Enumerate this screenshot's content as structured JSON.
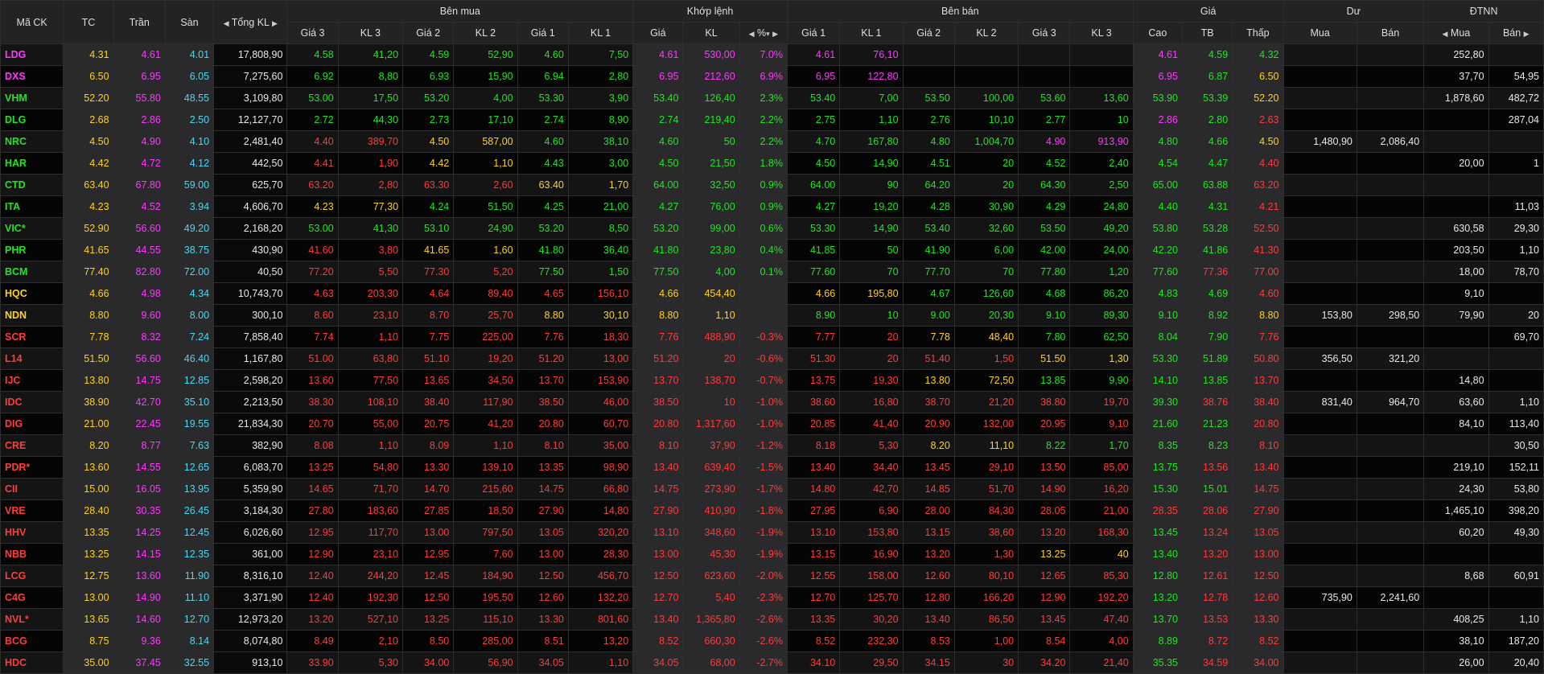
{
  "header": {
    "symbol": "Mã CK",
    "ref": "TC",
    "ceil": "Trần",
    "floor": "Sàn",
    "total_vol": "Tổng KL",
    "buy_side": "Bên mua",
    "matched": "Khớp lệnh",
    "sell_side": "Bên bán",
    "price": "Giá",
    "pending": "Dư",
    "foreign": "ĐTNN",
    "buy_cols": [
      "Giá 3",
      "KL 3",
      "Giá 2",
      "KL 2",
      "Giá 1",
      "KL 1"
    ],
    "match_cols": [
      "Giá",
      "KL",
      "%"
    ],
    "sell_cols": [
      "Giá 1",
      "KL 1",
      "Giá 2",
      "KL 2",
      "Giá 3",
      "KL 3"
    ],
    "price_cols": [
      "Cao",
      "TB",
      "Thấp"
    ],
    "pending_cols": [
      "Mua",
      "Bán"
    ],
    "foreign_cols": [
      "Mua",
      "Bán"
    ]
  },
  "colors": {
    "up": "#21e521",
    "down": "#ff3b3b",
    "ref": "#ffd21e",
    "ceiling": "#ff38ff",
    "floor": "#49d9f0"
  },
  "rows": [
    {
      "v": [
        "LDG",
        "4.31",
        "4.61",
        "4.01",
        "17,808,90",
        "4.58",
        "41,20",
        "4.59",
        "52,90",
        "4.60",
        "7,50",
        "4.61",
        "530,00",
        "7.0%",
        "4.61",
        "76,10",
        "",
        "",
        "",
        "",
        "4.61",
        "4.59",
        "4.32",
        "",
        "",
        "252,80",
        ""
      ],
      "c": "cerwcfwuuuuuuccccccwwwwwcuuwwww"
    },
    {
      "v": [
        "DXS",
        "6.50",
        "6.95",
        "6.05",
        "7,275,60",
        "6.92",
        "8,80",
        "6.93",
        "15,90",
        "6.94",
        "2,80",
        "6.95",
        "212,60",
        "6.9%",
        "6.95",
        "122,80",
        "",
        "",
        "",
        "",
        "6.95",
        "6.87",
        "6.50",
        "",
        "",
        "37,70",
        "54,95"
      ]
    },
    {
      "v": [
        "VHM",
        "52.20",
        "55.80",
        "48.55",
        "3,109,80",
        "53.00",
        "17,50",
        "53.20",
        "4,00",
        "53.30",
        "3,90",
        "53.40",
        "126,40",
        "2.3%",
        "53.40",
        "7,00",
        "53.50",
        "100,00",
        "53.60",
        "13,60",
        "53.90",
        "53.39",
        "52.20",
        "",
        "",
        "1,878,60",
        "482,72"
      ]
    },
    {
      "v": [
        "DLG",
        "2.68",
        "2.86",
        "2.50",
        "12,127,70",
        "2.72",
        "44,30",
        "2.73",
        "17,10",
        "2.74",
        "8,90",
        "2.74",
        "219,40",
        "2.2%",
        "2.75",
        "1,10",
        "2.76",
        "10,10",
        "2.77",
        "10",
        "2.86",
        "2.80",
        "2.63",
        "",
        "",
        "",
        "287,04"
      ]
    },
    {
      "v": [
        "NRC",
        "4.50",
        "4.90",
        "4.10",
        "2,481,40",
        "4.40",
        "389,70",
        "4.50",
        "587,00",
        "4.60",
        "38,10",
        "4.60",
        "50",
        "2.2%",
        "4.70",
        "167,80",
        "4.80",
        "1,004,70",
        "4.90",
        "913,90",
        "4.80",
        "4.66",
        "4.50",
        "1,480,90",
        "2,086,40",
        "",
        ""
      ]
    },
    {
      "v": [
        "HAR",
        "4.42",
        "4.72",
        "4.12",
        "442,50",
        "4.41",
        "1,90",
        "4.42",
        "1,10",
        "4.43",
        "3,00",
        "4.50",
        "21,50",
        "1.8%",
        "4.50",
        "14,90",
        "4.51",
        "20",
        "4.52",
        "2,40",
        "4.54",
        "4.47",
        "4.40",
        "",
        "",
        "20,00",
        "1"
      ]
    },
    {
      "v": [
        "CTD",
        "63.40",
        "67.80",
        "59.00",
        "625,70",
        "63.20",
        "2,80",
        "63.30",
        "2,60",
        "63.40",
        "1,70",
        "64.00",
        "32,50",
        "0.9%",
        "64.00",
        "90",
        "64.20",
        "20",
        "64.30",
        "2,50",
        "65.00",
        "63.88",
        "63.20",
        "",
        "",
        "",
        ""
      ]
    },
    {
      "v": [
        "ITA",
        "4.23",
        "4.52",
        "3.94",
        "4,606,70",
        "4.23",
        "77,30",
        "4.24",
        "51,50",
        "4.25",
        "21,00",
        "4.27",
        "76,00",
        "0.9%",
        "4.27",
        "19,20",
        "4.28",
        "30,90",
        "4.29",
        "24,80",
        "4.40",
        "4.31",
        "4.21",
        "",
        "",
        "",
        "11,03"
      ]
    },
    {
      "v": [
        "VIC*",
        "52.90",
        "56.60",
        "49.20",
        "2,168,20",
        "53.00",
        "41,30",
        "53.10",
        "24,90",
        "53.20",
        "8,50",
        "53.20",
        "99,00",
        "0.6%",
        "53.30",
        "14,90",
        "53.40",
        "32,60",
        "53.50",
        "49,20",
        "53.80",
        "53.28",
        "52.50",
        "",
        "",
        "630,58",
        "29,30"
      ]
    },
    {
      "v": [
        "PHR",
        "41.65",
        "44.55",
        "38.75",
        "430,90",
        "41.60",
        "3,80",
        "41.65",
        "1,60",
        "41.80",
        "36,40",
        "41.80",
        "23,80",
        "0.4%",
        "41.85",
        "50",
        "41.90",
        "6,00",
        "42.00",
        "24,00",
        "42.20",
        "41.86",
        "41.30",
        "",
        "",
        "203,50",
        "1,10"
      ]
    },
    {
      "v": [
        "BCM",
        "77.40",
        "82.80",
        "72.00",
        "40,50",
        "77.20",
        "5,50",
        "77.30",
        "5,20",
        "77.50",
        "1,50",
        "77.50",
        "4,00",
        "0.1%",
        "77.60",
        "70",
        "77.70",
        "70",
        "77.80",
        "1,20",
        "77.60",
        "77.36",
        "77.00",
        "",
        "",
        "18,00",
        "78,70"
      ]
    },
    {
      "v": [
        "HQC",
        "4.66",
        "4.98",
        "4.34",
        "10,743,70",
        "4.63",
        "203,30",
        "4.64",
        "89,40",
        "4.65",
        "156,10",
        "4.66",
        "454,40",
        "",
        "4.66",
        "195,80",
        "4.67",
        "126,60",
        "4.68",
        "86,20",
        "4.83",
        "4.69",
        "4.60",
        "",
        "",
        "9,10",
        ""
      ]
    },
    {
      "v": [
        "NDN",
        "8.80",
        "9.60",
        "8.00",
        "300,10",
        "8.60",
        "23,10",
        "8.70",
        "25,70",
        "8.80",
        "30,10",
        "8.80",
        "1,10",
        "",
        "8.90",
        "10",
        "9.00",
        "20,30",
        "9.10",
        "89,30",
        "9.10",
        "8.92",
        "8.80",
        "153,80",
        "298,50",
        "79,90",
        "20"
      ]
    },
    {
      "v": [
        "SCR",
        "7.78",
        "8.32",
        "7.24",
        "7,858,40",
        "7.74",
        "1,10",
        "7.75",
        "225,00",
        "7.76",
        "18,30",
        "7.76",
        "488,90",
        "-0.3%",
        "7.77",
        "20",
        "7.78",
        "48,40",
        "7.80",
        "62,50",
        "8.04",
        "7.90",
        "7.76",
        "",
        "",
        "",
        "69,70"
      ]
    },
    {
      "v": [
        "L14",
        "51.50",
        "56.60",
        "46.40",
        "1,167,80",
        "51.00",
        "63,80",
        "51.10",
        "19,20",
        "51.20",
        "13,00",
        "51.20",
        "20",
        "-0.6%",
        "51.30",
        "20",
        "51.40",
        "1,50",
        "51.50",
        "1,30",
        "53.30",
        "51.89",
        "50.80",
        "356,50",
        "321,20",
        "",
        ""
      ]
    },
    {
      "v": [
        "IJC",
        "13.80",
        "14.75",
        "12.85",
        "2,598,20",
        "13.60",
        "77,50",
        "13.65",
        "34,50",
        "13.70",
        "153,90",
        "13.70",
        "138,70",
        "-0.7%",
        "13.75",
        "19,30",
        "13.80",
        "72,50",
        "13.85",
        "9,90",
        "14.10",
        "13.85",
        "13.70",
        "",
        "",
        "14,80",
        ""
      ]
    },
    {
      "v": [
        "IDC",
        "38.90",
        "42.70",
        "35.10",
        "2,213,50",
        "38.30",
        "108,10",
        "38.40",
        "117,90",
        "38.50",
        "46,00",
        "38.50",
        "10",
        "-1.0%",
        "38.60",
        "16,80",
        "38.70",
        "21,20",
        "38.80",
        "19,70",
        "39.30",
        "38.76",
        "38.40",
        "831,40",
        "964,70",
        "63,60",
        "1,10"
      ]
    },
    {
      "v": [
        "DIG",
        "21.00",
        "22.45",
        "19.55",
        "21,834,30",
        "20.70",
        "55,00",
        "20.75",
        "41,20",
        "20.80",
        "60,70",
        "20.80",
        "1,317,60",
        "-1.0%",
        "20.85",
        "41,40",
        "20.90",
        "132,00",
        "20.95",
        "9,10",
        "21.60",
        "21.23",
        "20.80",
        "",
        "",
        "84,10",
        "113,40"
      ]
    },
    {
      "v": [
        "CRE",
        "8.20",
        "8.77",
        "7.63",
        "382,90",
        "8.08",
        "1,10",
        "8.09",
        "1,10",
        "8.10",
        "35,00",
        "8.10",
        "37,90",
        "-1.2%",
        "8.18",
        "5,30",
        "8.20",
        "11,10",
        "8.22",
        "1,70",
        "8.35",
        "8.23",
        "8.10",
        "",
        "",
        "",
        "30,50"
      ]
    },
    {
      "v": [
        "PDR*",
        "13.60",
        "14.55",
        "12.65",
        "6,083,70",
        "13.25",
        "54,80",
        "13.30",
        "139,10",
        "13.35",
        "98,90",
        "13.40",
        "639,40",
        "-1.5%",
        "13.40",
        "34,40",
        "13.45",
        "29,10",
        "13.50",
        "85,00",
        "13.75",
        "13.56",
        "13.40",
        "",
        "",
        "219,10",
        "152,11"
      ]
    },
    {
      "v": [
        "CII",
        "15.00",
        "16.05",
        "13.95",
        "5,359,90",
        "14.65",
        "71,70",
        "14.70",
        "215,60",
        "14.75",
        "66,80",
        "14.75",
        "273,90",
        "-1.7%",
        "14.80",
        "42,70",
        "14.85",
        "51,70",
        "14.90",
        "16,20",
        "15.30",
        "15.01",
        "14.75",
        "",
        "",
        "24,30",
        "53,80"
      ]
    },
    {
      "v": [
        "VRE",
        "28.40",
        "30.35",
        "26.45",
        "3,184,30",
        "27.80",
        "183,60",
        "27.85",
        "18,50",
        "27.90",
        "14,80",
        "27.90",
        "410,90",
        "-1.8%",
        "27.95",
        "6,90",
        "28.00",
        "84,30",
        "28.05",
        "21,00",
        "28.35",
        "28.06",
        "27.90",
        "",
        "",
        "1,465,10",
        "398,20"
      ]
    },
    {
      "v": [
        "HHV",
        "13.35",
        "14.25",
        "12.45",
        "6,026,60",
        "12.95",
        "117,70",
        "13.00",
        "797,50",
        "13.05",
        "320,20",
        "13.10",
        "348,60",
        "-1.9%",
        "13.10",
        "153,80",
        "13.15",
        "38,60",
        "13.20",
        "168,30",
        "13.45",
        "13.24",
        "13.05",
        "",
        "",
        "60,20",
        "49,30"
      ]
    },
    {
      "v": [
        "NBB",
        "13.25",
        "14.15",
        "12.35",
        "361,00",
        "12.90",
        "23,10",
        "12.95",
        "7,60",
        "13.00",
        "28,30",
        "13.00",
        "45,30",
        "-1.9%",
        "13.15",
        "16,90",
        "13.20",
        "1,30",
        "13.25",
        "40",
        "13.40",
        "13.20",
        "13.00",
        "",
        "",
        "",
        ""
      ]
    },
    {
      "v": [
        "LCG",
        "12.75",
        "13.60",
        "11.90",
        "8,316,10",
        "12.40",
        "244,20",
        "12.45",
        "184,90",
        "12.50",
        "456,70",
        "12.50",
        "623,60",
        "-2.0%",
        "12.55",
        "158,00",
        "12.60",
        "80,10",
        "12.65",
        "85,30",
        "12.80",
        "12.61",
        "12.50",
        "",
        "",
        "8,68",
        "60,91"
      ]
    },
    {
      "v": [
        "C4G",
        "13.00",
        "14.90",
        "11.10",
        "3,371,90",
        "12.40",
        "192,30",
        "12.50",
        "195,50",
        "12.60",
        "132,20",
        "12.70",
        "5,40",
        "-2.3%",
        "12.70",
        "125,70",
        "12.80",
        "166,20",
        "12.90",
        "192,20",
        "13.20",
        "12.78",
        "12.60",
        "735,90",
        "2,241,60",
        "",
        ""
      ]
    },
    {
      "v": [
        "NVL*",
        "13.65",
        "14.60",
        "12.70",
        "12,973,20",
        "13.20",
        "527,10",
        "13.25",
        "115,10",
        "13.30",
        "801,60",
        "13.40",
        "1,365,80",
        "-2.6%",
        "13.35",
        "30,20",
        "13.40",
        "86,50",
        "13.45",
        "47,40",
        "13.70",
        "13.53",
        "13.30",
        "",
        "",
        "408,25",
        "1,10"
      ]
    },
    {
      "v": [
        "BCG",
        "8.75",
        "9.36",
        "8.14",
        "8,074,80",
        "8.49",
        "2,10",
        "8.50",
        "285,00",
        "8.51",
        "13,20",
        "8.52",
        "660,30",
        "-2.6%",
        "8.52",
        "232,30",
        "8.53",
        "1,00",
        "8.54",
        "4,00",
        "8.89",
        "8.72",
        "8.52",
        "",
        "",
        "38,10",
        "187,20"
      ]
    },
    {
      "v": [
        "HDC",
        "35.00",
        "37.45",
        "32.55",
        "913,10",
        "33.90",
        "5,30",
        "34.00",
        "56,90",
        "34.05",
        "1,10",
        "34.05",
        "68,00",
        "-2.7%",
        "34.10",
        "29,50",
        "34.15",
        "30",
        "34.20",
        "21,40",
        "35.35",
        "34.59",
        "34.00",
        "",
        "",
        "26,00",
        "20,40"
      ]
    }
  ],
  "row_colors": [
    "cerwfwuuuuuuccccccwwwwwcuuwwww",
    "cerwfwuuuuuuccccccwwwwwcuuwwww",
    "uerwfwuuuuuuuuuuuuuuuuuuuuurwwww",
    "rerwfwuuuuuuuuuuuuuuuuuuucudwwww",
    "rerwfwddddrruuuuuuuuuuuucurrwwww",
    "rerwfwddrruuuuuuuuuuuuuuuuudwwww",
    "rerwfwddddrruuuuuuuuuuuuuuudwwww",
    "rerwfwrruuuuuuuuuuuuuuuuuuudwwww",
    "uerwfwuuuuuuuuuuuuuuuuuuuuudwwww",
    "uerwfwddrrruuuuuuuuuuuuuuuudwwww",
    "uerwfwdddduuuuuuuuuuuuuuuudwwww",
    "rerwfwddddddrrrrwrruuuuuuuudwwww",
    "rerwfwddddrrrrrwuuuuuuuuuurwwww"
  ]
}
